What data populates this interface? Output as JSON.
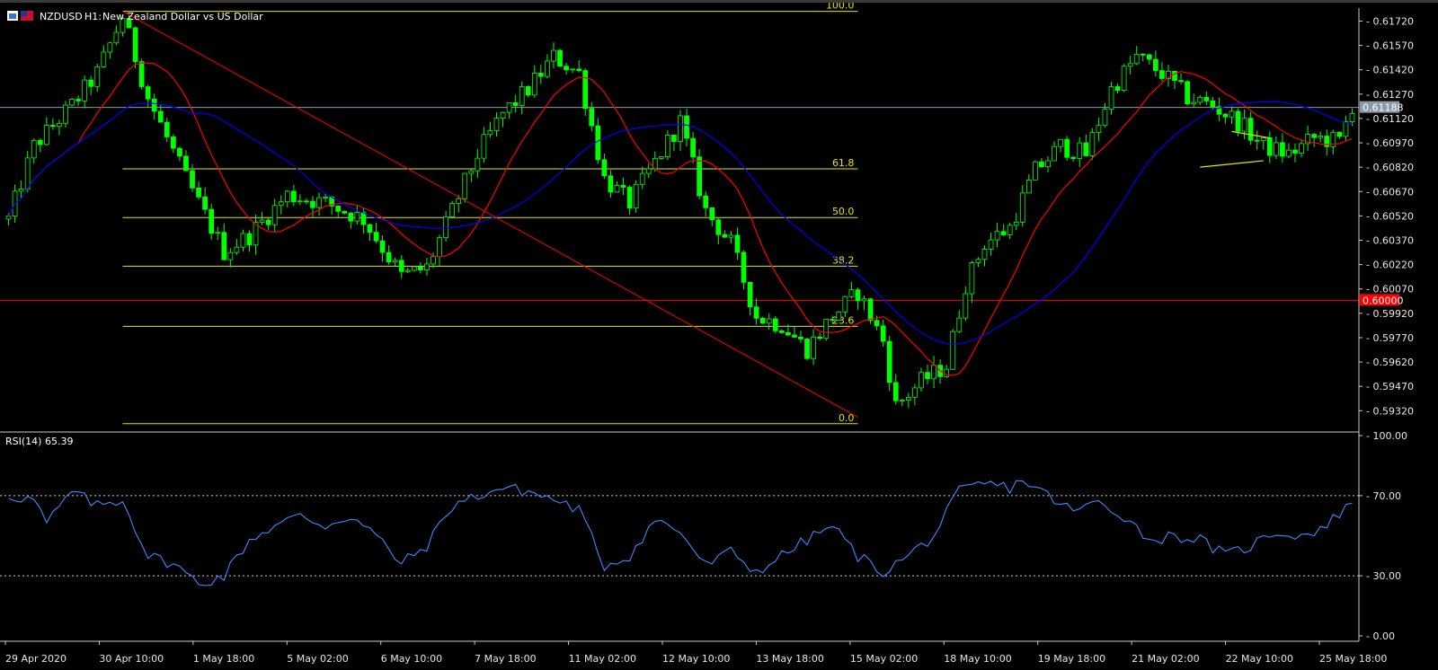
{
  "header": {
    "symbol": "NZDUSD",
    "timeframe": "H1:",
    "description": "New Zealand Dollar vs US Dollar"
  },
  "colors": {
    "background": "#000000",
    "candle": "#00ff00",
    "ma_fast": "#ff0000",
    "ma_slow": "#0000ff",
    "fib": "#e6e600",
    "trendline": "#ff0000",
    "support": "#ff0000",
    "rsi": "#3d8bff",
    "current_price_tag": "#8c9aa8",
    "support_tag": "#ff0000",
    "triangle": "#e6e600"
  },
  "icons": [
    "chart-window-icon",
    "flag-icon"
  ],
  "chart_data": [
    {
      "type": "candlestick",
      "title": "NZDUSD, H1: New Zealand Dollar vs US Dollar",
      "ylim": [
        0.592,
        0.618
      ],
      "y_ticks": [
        "0.61720",
        "0.61570",
        "0.61420",
        "0.61270",
        "0.61120",
        "0.60970",
        "0.60820",
        "0.60670",
        "0.60520",
        "0.60370",
        "0.60220",
        "0.60070",
        "0.59920",
        "0.59770",
        "0.59620",
        "0.59470",
        "0.59320"
      ],
      "x_ticks": [
        "29 Apr 2020",
        "30 Apr 10:00",
        "1 May 18:00",
        "5 May 02:00",
        "6 May 10:00",
        "7 May 18:00",
        "11 May 02:00",
        "12 May 10:00",
        "13 May 18:00",
        "15 May 02:00",
        "18 May 10:00",
        "19 May 18:00",
        "21 May 02:00",
        "22 May 10:00",
        "25 May 18:00"
      ],
      "price_anchors": [
        {
          "x": 0,
          "y": 0.605
        },
        {
          "x": 4,
          "y": 0.6095
        },
        {
          "x": 10,
          "y": 0.612
        },
        {
          "x": 14,
          "y": 0.614
        },
        {
          "x": 18,
          "y": 0.6175
        },
        {
          "x": 22,
          "y": 0.6125
        },
        {
          "x": 28,
          "y": 0.6075
        },
        {
          "x": 34,
          "y": 0.603
        },
        {
          "x": 38,
          "y": 0.604
        },
        {
          "x": 44,
          "y": 0.6065
        },
        {
          "x": 50,
          "y": 0.606
        },
        {
          "x": 56,
          "y": 0.605
        },
        {
          "x": 62,
          "y": 0.6015
        },
        {
          "x": 66,
          "y": 0.602
        },
        {
          "x": 70,
          "y": 0.6055
        },
        {
          "x": 74,
          "y": 0.609
        },
        {
          "x": 78,
          "y": 0.6115
        },
        {
          "x": 82,
          "y": 0.613
        },
        {
          "x": 86,
          "y": 0.615
        },
        {
          "x": 90,
          "y": 0.614
        },
        {
          "x": 94,
          "y": 0.6075
        },
        {
          "x": 98,
          "y": 0.606
        },
        {
          "x": 102,
          "y": 0.6085
        },
        {
          "x": 106,
          "y": 0.611
        },
        {
          "x": 110,
          "y": 0.6055
        },
        {
          "x": 114,
          "y": 0.6035
        },
        {
          "x": 118,
          "y": 0.599
        },
        {
          "x": 122,
          "y": 0.5985
        },
        {
          "x": 126,
          "y": 0.597
        },
        {
          "x": 130,
          "y": 0.599
        },
        {
          "x": 134,
          "y": 0.6005
        },
        {
          "x": 138,
          "y": 0.5975
        },
        {
          "x": 140,
          "y": 0.5935
        },
        {
          "x": 144,
          "y": 0.595
        },
        {
          "x": 148,
          "y": 0.596
        },
        {
          "x": 151,
          "y": 0.601
        },
        {
          "x": 154,
          "y": 0.6035
        },
        {
          "x": 158,
          "y": 0.6045
        },
        {
          "x": 162,
          "y": 0.608
        },
        {
          "x": 166,
          "y": 0.6095
        },
        {
          "x": 170,
          "y": 0.609
        },
        {
          "x": 174,
          "y": 0.613
        },
        {
          "x": 178,
          "y": 0.615
        },
        {
          "x": 182,
          "y": 0.614
        },
        {
          "x": 186,
          "y": 0.6125
        },
        {
          "x": 190,
          "y": 0.612
        },
        {
          "x": 194,
          "y": 0.611
        },
        {
          "x": 198,
          "y": 0.6095
        },
        {
          "x": 202,
          "y": 0.609
        },
        {
          "x": 206,
          "y": 0.61
        },
        {
          "x": 210,
          "y": 0.6098
        },
        {
          "x": 212,
          "y": 0.612
        }
      ],
      "bars": 213,
      "current_price": {
        "value": 0.61188,
        "label": "0.61188"
      },
      "support_level": {
        "value": 0.6,
        "label": "0.60000"
      },
      "moving_averages": [
        {
          "period_hint": "fast",
          "color": "#ff0000"
        },
        {
          "period_hint": "slow",
          "color": "#0000ff"
        }
      ],
      "fibonacci": {
        "from_bar": 18,
        "to_bar": 134,
        "high": 0.6178,
        "low": 0.5924,
        "levels": [
          {
            "ratio": 1.0,
            "label": "100.0"
          },
          {
            "ratio": 0.618,
            "label": "61.8"
          },
          {
            "ratio": 0.5,
            "label": "50.0"
          },
          {
            "ratio": 0.382,
            "label": "38.2"
          },
          {
            "ratio": 0.236,
            "label": "23.6"
          },
          {
            "ratio": 0.0,
            "label": "0.0"
          }
        ]
      },
      "trendline": {
        "from": {
          "x": 18,
          "y": 0.6178
        },
        "to": {
          "x": 134,
          "y": 0.5928
        }
      },
      "triangle": {
        "upper": [
          {
            "x": 193,
            "y": 0.6104
          },
          {
            "x": 199,
            "y": 0.61
          }
        ],
        "lower": [
          {
            "x": 188,
            "y": 0.6082
          },
          {
            "x": 198,
            "y": 0.6086
          }
        ]
      }
    },
    {
      "type": "line",
      "title": "RSI(14) 65.39",
      "ylim": [
        0,
        100
      ],
      "y_ticks": [
        "100.00",
        "70.00",
        "30.00",
        "0.00"
      ],
      "levels": [
        70,
        30
      ],
      "anchors": [
        {
          "x": 0,
          "y": 70
        },
        {
          "x": 4,
          "y": 68
        },
        {
          "x": 6,
          "y": 56
        },
        {
          "x": 10,
          "y": 72
        },
        {
          "x": 14,
          "y": 65
        },
        {
          "x": 18,
          "y": 68
        },
        {
          "x": 22,
          "y": 40
        },
        {
          "x": 26,
          "y": 36
        },
        {
          "x": 30,
          "y": 26
        },
        {
          "x": 34,
          "y": 30
        },
        {
          "x": 38,
          "y": 48
        },
        {
          "x": 42,
          "y": 55
        },
        {
          "x": 46,
          "y": 60
        },
        {
          "x": 50,
          "y": 55
        },
        {
          "x": 54,
          "y": 60
        },
        {
          "x": 58,
          "y": 50
        },
        {
          "x": 62,
          "y": 36
        },
        {
          "x": 66,
          "y": 45
        },
        {
          "x": 70,
          "y": 65
        },
        {
          "x": 74,
          "y": 70
        },
        {
          "x": 78,
          "y": 74
        },
        {
          "x": 82,
          "y": 72
        },
        {
          "x": 86,
          "y": 68
        },
        {
          "x": 90,
          "y": 63
        },
        {
          "x": 94,
          "y": 35
        },
        {
          "x": 98,
          "y": 40
        },
        {
          "x": 102,
          "y": 58
        },
        {
          "x": 106,
          "y": 52
        },
        {
          "x": 110,
          "y": 35
        },
        {
          "x": 114,
          "y": 42
        },
        {
          "x": 118,
          "y": 32
        },
        {
          "x": 122,
          "y": 40
        },
        {
          "x": 126,
          "y": 48
        },
        {
          "x": 130,
          "y": 55
        },
        {
          "x": 134,
          "y": 40
        },
        {
          "x": 138,
          "y": 32
        },
        {
          "x": 142,
          "y": 40
        },
        {
          "x": 146,
          "y": 50
        },
        {
          "x": 150,
          "y": 72
        },
        {
          "x": 154,
          "y": 76
        },
        {
          "x": 158,
          "y": 74
        },
        {
          "x": 160,
          "y": 78
        },
        {
          "x": 164,
          "y": 70
        },
        {
          "x": 168,
          "y": 62
        },
        {
          "x": 172,
          "y": 67
        },
        {
          "x": 176,
          "y": 60
        },
        {
          "x": 180,
          "y": 48
        },
        {
          "x": 184,
          "y": 50
        },
        {
          "x": 188,
          "y": 48
        },
        {
          "x": 192,
          "y": 40
        },
        {
          "x": 196,
          "y": 45
        },
        {
          "x": 200,
          "y": 52
        },
        {
          "x": 204,
          "y": 50
        },
        {
          "x": 208,
          "y": 55
        },
        {
          "x": 212,
          "y": 68
        }
      ]
    }
  ]
}
